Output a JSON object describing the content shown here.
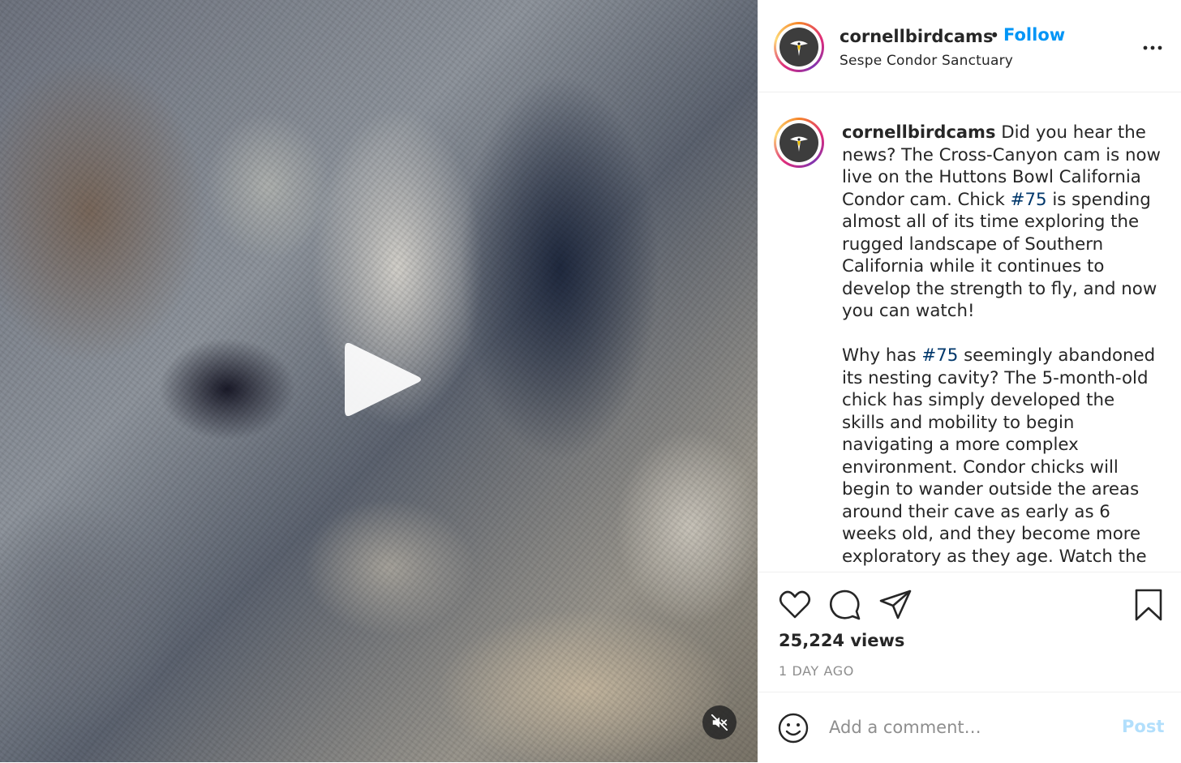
{
  "header": {
    "username": "cornellbirdcams",
    "separator": "•",
    "follow_label": "Follow",
    "location": "Sespe Condor Sanctuary"
  },
  "caption": {
    "username": "cornellbirdcams",
    "p1_a": " Did you hear the news? The Cross-Canyon cam is now live on the Huttons Bowl California Condor cam. Chick ",
    "hashtag1": "#75",
    "p1_b": " is spending almost all of its time exploring the rugged landscape of Southern California while it continues to develop the strength to fly, and now you can watch!",
    "p2_a": "Why has ",
    "hashtag2": "#75",
    "p2_b": " seemingly abandoned its nesting cavity? The 5-month-old chick has simply developed the skills and mobility to begin navigating a more complex environment. Condor chicks will begin to wander outside the areas around their cave as early as 6 weeks old, and they become more exploratory as they age. Watch the cam to see the chick scale rocky"
  },
  "stats": {
    "views": "25,224 views",
    "time_ago": "1 DAY AGO"
  },
  "comment": {
    "placeholder": "Add a comment…",
    "post_label": "Post"
  },
  "icons": {
    "media": [
      "play-icon",
      "muted-speaker-icon"
    ],
    "actions": [
      "heart-icon",
      "comment-icon",
      "share-icon",
      "bookmark-icon"
    ],
    "other": [
      "more-options-icon",
      "emoji-icon",
      "bird-logo-icon"
    ]
  },
  "colors": {
    "follow": "#0095f6",
    "hashtag": "#00376b",
    "post_disabled": "#b2dffc",
    "secondary_text": "#8e8e8e"
  }
}
